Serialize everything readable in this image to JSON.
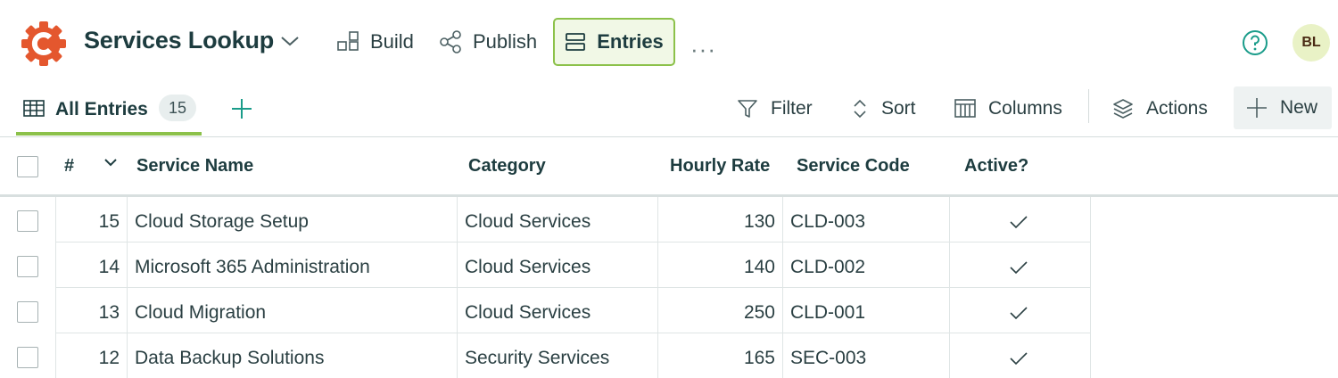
{
  "app": {
    "title": "Services Lookup",
    "logo_icon": "cog-c-logo-icon",
    "brand_color": "#e4572e"
  },
  "nav": {
    "build_label": "Build",
    "publish_label": "Publish",
    "entries_label": "Entries",
    "more_label": "···",
    "active": "Entries",
    "accent": "#8cc14a"
  },
  "user": {
    "initials": "BL"
  },
  "views": {
    "current_label": "All Entries",
    "count": "15"
  },
  "toolbar": {
    "filter_label": "Filter",
    "sort_label": "Sort",
    "columns_label": "Columns",
    "actions_label": "Actions",
    "new_label": "New"
  },
  "table": {
    "columns": [
      "#",
      "Service Name",
      "Category",
      "Hourly Rate",
      "Service Code",
      "Active?"
    ],
    "rows": [
      {
        "id": "15",
        "name": "Cloud Storage Setup",
        "category": "Cloud Services",
        "rate": "130",
        "code": "CLD-003",
        "active": true
      },
      {
        "id": "14",
        "name": "Microsoft 365 Administration",
        "category": "Cloud Services",
        "rate": "140",
        "code": "CLD-002",
        "active": true
      },
      {
        "id": "13",
        "name": "Cloud Migration",
        "category": "Cloud Services",
        "rate": "250",
        "code": "CLD-001",
        "active": true
      },
      {
        "id": "12",
        "name": "Data Backup Solutions",
        "category": "Security Services",
        "rate": "165",
        "code": "SEC-003",
        "active": true
      }
    ]
  }
}
